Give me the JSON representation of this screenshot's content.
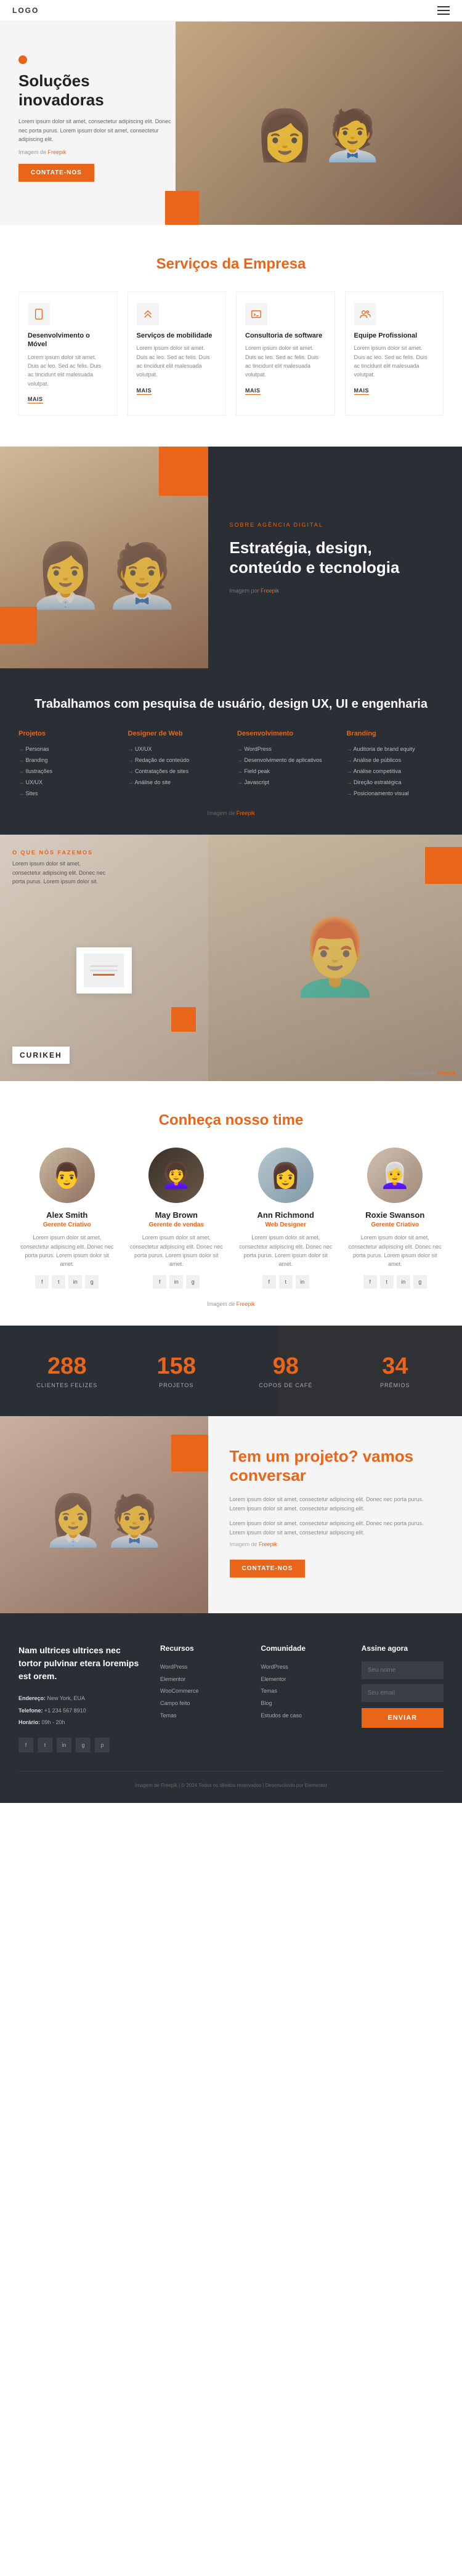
{
  "header": {
    "logo": "logo",
    "hamburger_label": "menu"
  },
  "hero": {
    "title": "Soluções inovadoras",
    "description": "Lorem ipsum dolor sit amet, consectetur adipiscing elit. Donec nec porta purus. Lorem ipsum dolor sit amet, consectetur adipiscing elit.",
    "image_credit_pre": "Imagem de",
    "image_credit_link": "Freepik",
    "btn_label": "CONTATE-NOS"
  },
  "services": {
    "section_title": "Serviços da Empresa",
    "cards": [
      {
        "icon": "mobile",
        "name": "Desenvolvimento o Móvel",
        "desc": "Lorem ipsum dolor sit amet. Duis ac leo. Sed ac felis. Duis ac tincidunt elit malesuada volutpat.",
        "mais": "MAIS"
      },
      {
        "icon": "mobility",
        "name": "Serviços de mobilidade",
        "desc": "Lorem ipsum dolor sit amet. Duis ac leo. Sed ac felis. Duis ac tincidunt elit malesuada volutpat.",
        "mais": "MAIS"
      },
      {
        "icon": "software",
        "name": "Consultoria de software",
        "desc": "Lorem ipsum dolor sit amet. Duis ac leo. Sed ac felis. Duis ac tincidunt elit malesuada volutpat.",
        "mais": "MAIS"
      },
      {
        "icon": "team",
        "name": "Equipe Profissional",
        "desc": "Lorem ipsum dolor sit amet. Duis ac leo. Sed ac felis. Duis ac tincidunt elit malesuada volutpat.",
        "mais": "MAIS"
      }
    ]
  },
  "strategy": {
    "label": "SOBRE AGÊNCIA DIGITAL",
    "title": "Estratégia, design, conteúdo e tecnologia",
    "credit_pre": "Imagem por",
    "credit_link": "Freepik"
  },
  "research": {
    "title": "Trabalhamos com pesquisa de usuário, design UX, UI e engenharia",
    "columns": [
      {
        "title": "Projetos",
        "items": [
          "Personas",
          "Branding",
          "Ilustrações",
          "UX/UX",
          "Sites"
        ]
      },
      {
        "title": "Designer de Web",
        "items": [
          "UX/UX",
          "Redação de conteúdo",
          "Contratações de sites",
          "Análise do site"
        ]
      },
      {
        "title": "Desenvolvimento",
        "items": [
          "WordPress",
          "Desenvolvimento de aplicativos",
          "Field peak",
          "Javascript"
        ]
      },
      {
        "title": "Branding",
        "items": [
          "Auditoria de brand equity",
          "Análise de públicos",
          "Análise competitiva",
          "Direção estratégica",
          "Posicionamento visual"
        ]
      }
    ],
    "credit_pre": "Imagem de",
    "credit_link": "Freepik"
  },
  "whatwedo": {
    "label": "O QUE NÓS FAZEMOS",
    "desc": "Lorem ipsum dolor sit amet, consectetur adipiscing elit. Donec nec porta purus. Lorem ipsum dolor sit.",
    "brand_name": "CURIKEH",
    "credit_pre": "Imagem de",
    "credit_link": "Freepik"
  },
  "team": {
    "section_title": "Conheça nosso time",
    "credit_pre": "Imagem de",
    "credit_link": "Freepik",
    "members": [
      {
        "name": "Alex Smith",
        "role": "Gerente Criativo",
        "desc": "Lorem ipsum dolor sit amet, consectetur adipiscing elit. Donec nec porta purus. Lorem ipsum dolor sit amet.",
        "socials": [
          "f",
          "t",
          "in",
          "g"
        ]
      },
      {
        "name": "May Brown",
        "role": "Gerente de vendas",
        "desc": "Lorem ipsum dolor sit amet, consectetur adipiscing elit. Donec nec porta purus. Lorem ipsum dolor sit amet.",
        "socials": [
          "f",
          "in",
          "g"
        ]
      },
      {
        "name": "Ann Richmond",
        "role": "Web Designer",
        "desc": "Lorem ipsum dolor sit amet, consectetur adipiscing elit. Donec nec porta purus. Lorem ipsum dolor sit amet.",
        "socials": [
          "f",
          "t",
          "in"
        ]
      },
      {
        "name": "Roxie Swanson",
        "role": "Gerente Criativo",
        "desc": "Lorem ipsum dolor sit amet, consectetur adipiscing elit. Donec nec porta purus. Lorem ipsum dolor sit amet.",
        "socials": [
          "f",
          "t",
          "in",
          "g"
        ]
      }
    ]
  },
  "stats": {
    "items": [
      {
        "number": "288",
        "label": "CLIENTES FELIZES"
      },
      {
        "number": "158",
        "label": "PROJETOS"
      },
      {
        "number": "98",
        "label": "COPOS DE CAFÉ"
      },
      {
        "number": "34",
        "label": "PRÊMIOS"
      }
    ]
  },
  "project_cta": {
    "title": "Tem um projeto? vamos conversar",
    "text1": "Lorem ipsum dolor sit amet, consectetur adipiscing elit. Donec nec porta purus. Lorem ipsum dolor sit amet, consectetur adipiscing elit.",
    "text2": "Lorem ipsum dolor sit amet, consectetur adipiscing elit. Donec nec porta purus. Lorem ipsum dolor sit amet, consectetur adipiscing elit.",
    "credit_pre": "Imagem de",
    "credit_link": "Freepik",
    "btn_label": "CONTATE-NOS"
  },
  "footer": {
    "brand_text": "Nam ultrices ultrices nec tortor pulvinar etera loremips est orem.",
    "address_label": "Endereço:",
    "address_val": "New York, EUA",
    "phone_label": "Telefone:",
    "phone_val": "+1 234 567 8910",
    "hours_label": "Horário:",
    "hours_val": "09h - 20h",
    "socials": [
      "f",
      "t",
      "in",
      "g",
      "p"
    ],
    "columns": [
      {
        "title": "Recursos",
        "items": [
          "WordPress",
          "Elementor",
          "WooCommerce",
          "Campo feito",
          "Temas"
        ]
      },
      {
        "title": "Comunidade",
        "items": [
          "WordPress",
          "Elementor",
          "Temas",
          "Blog",
          "Estudos de caso"
        ]
      }
    ],
    "form": {
      "title": "Assine agora",
      "placeholder_name": "Seu nome",
      "placeholder_email": "Seu email",
      "btn_label": "ENVIAR"
    },
    "bottom_text": "Imagem de Freepik | © 2024 Todos os direitos reservados | Desenvolvido por Elementor"
  }
}
